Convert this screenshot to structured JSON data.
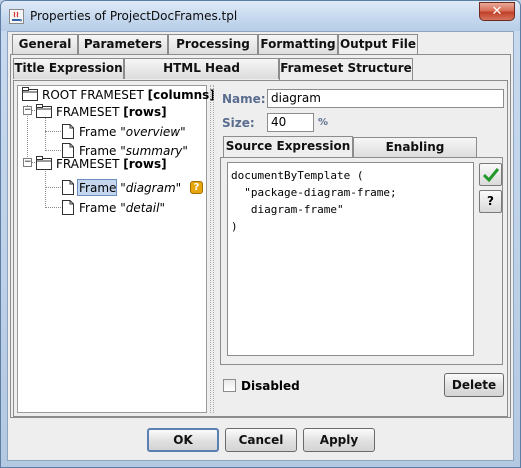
{
  "window": {
    "title": "Properties of ProjectDocFrames.tpl",
    "close_label": "✕"
  },
  "main_tabs": [
    {
      "label": "General",
      "active": false
    },
    {
      "label": "Parameters",
      "active": false
    },
    {
      "label": "Processing",
      "active": false
    },
    {
      "label": "Formatting",
      "active": false
    },
    {
      "label": "Output File",
      "active": true
    }
  ],
  "sub_tabs": [
    {
      "label": "Title Expression",
      "active": false
    },
    {
      "label": "HTML Head Expression",
      "active": false
    },
    {
      "label": "Frameset Structure",
      "active": true
    }
  ],
  "tree": {
    "root": {
      "prefix": "ROOT FRAMESET ",
      "kind": "[columns]"
    },
    "frameset1": {
      "prefix": "FRAMESET ",
      "kind": "[rows]",
      "expander": "−"
    },
    "frame_overview": {
      "prefix": "Frame ",
      "name": "\"overview\""
    },
    "frame_summary": {
      "prefix": "Frame ",
      "name": "\"summary\""
    },
    "frameset2": {
      "prefix": "FRAMESET ",
      "kind": "[rows]",
      "expander": "−"
    },
    "frame_diagram": {
      "prefix": "Frame",
      "name": "\"diagram\"",
      "selected": true,
      "badge": "?"
    },
    "frame_detail": {
      "prefix": "Frame ",
      "name": "\"detail\""
    }
  },
  "form": {
    "name_label": "Name:",
    "name_value": "diagram",
    "size_label": "Size:",
    "size_value": "40",
    "size_unit": "%"
  },
  "expr_tabs": [
    {
      "label": "Source Expression",
      "active": true
    },
    {
      "label": "Enabling Condition",
      "active": false
    }
  ],
  "source_expression": "documentByTemplate (\n  \"package-diagram-frame;\n   diagram-frame\"\n)",
  "side_buttons": {
    "check": "✔",
    "help": "?"
  },
  "disabled_checkbox": {
    "label": "Disabled",
    "checked": false
  },
  "delete_label": "Delete",
  "buttons": {
    "ok": "OK",
    "cancel": "Cancel",
    "apply": "Apply"
  }
}
